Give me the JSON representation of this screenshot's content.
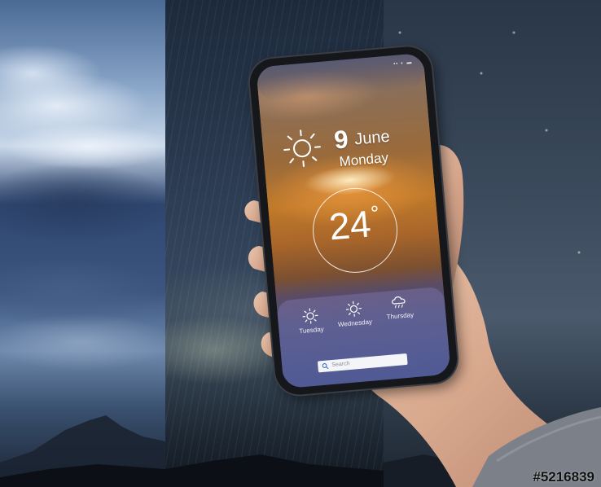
{
  "weather_app": {
    "date_day": "9",
    "date_month": "June",
    "weekday": "Monday",
    "temperature": "24",
    "temperature_unit": "°",
    "forecast": [
      {
        "day": "Tuesday",
        "icon": "sun-icon"
      },
      {
        "day": "Wednesday",
        "icon": "sun-icon"
      },
      {
        "day": "Thursday",
        "icon": "rain-cloud-icon"
      }
    ],
    "search_placeholder": "Search"
  },
  "watermark": "#5216839",
  "colors": {
    "screen_warm": "#c07a2a",
    "forecast_card": "#4d5480",
    "search_box": "#f4f5f8",
    "phone_frame": "#15171b"
  }
}
